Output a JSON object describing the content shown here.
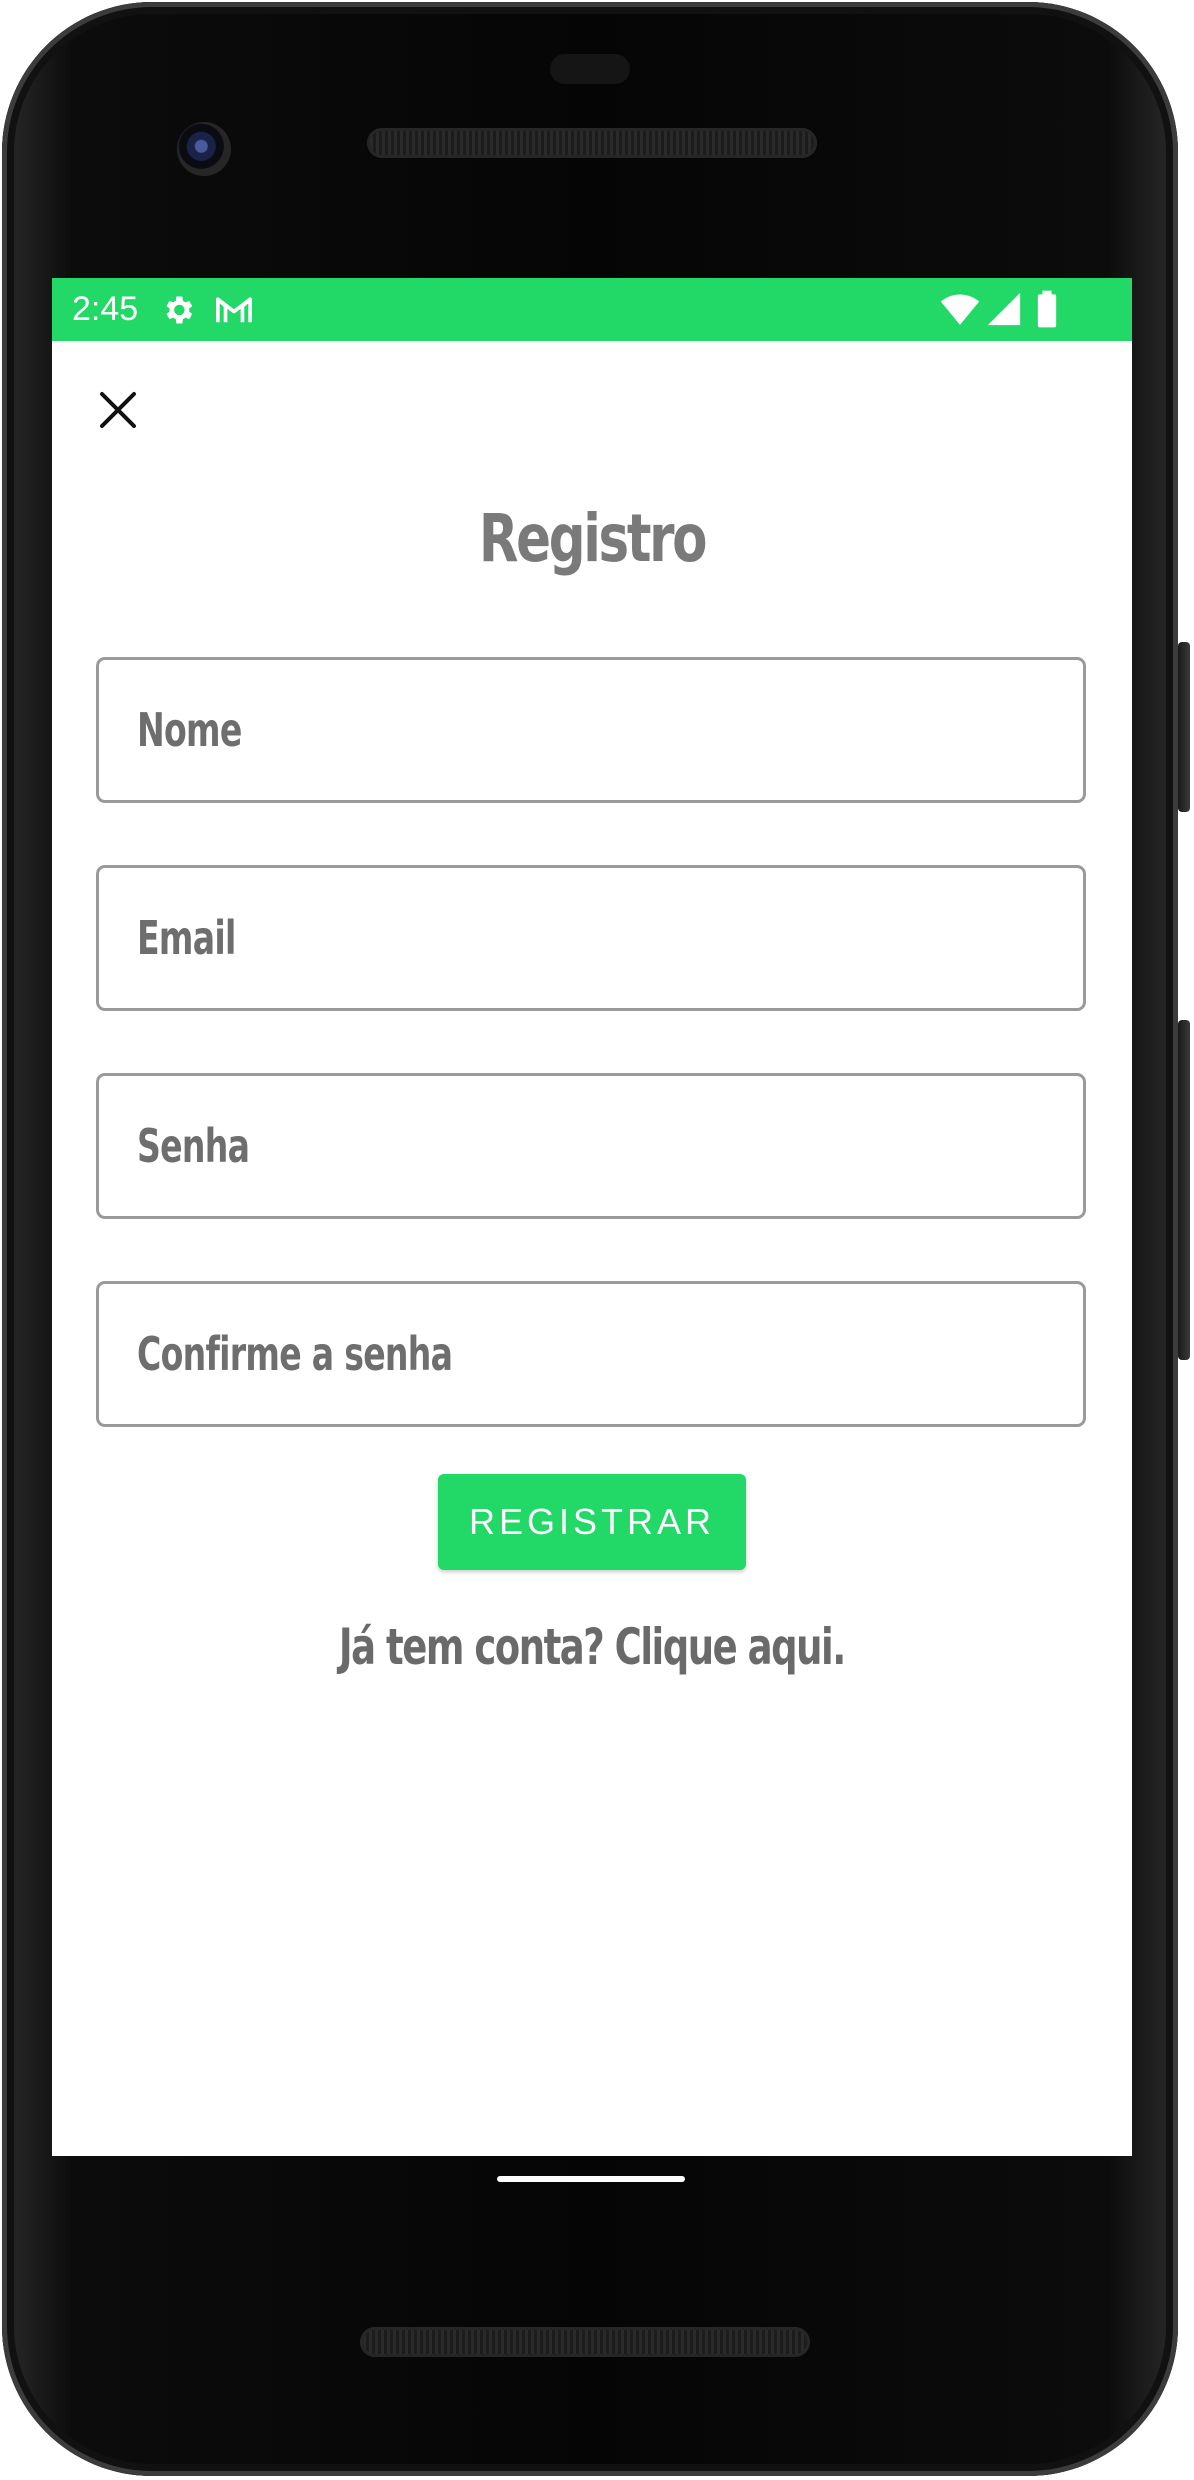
{
  "status_bar": {
    "time": "2:45",
    "color": "#22d866",
    "icons": [
      "settings-icon",
      "gmail-icon",
      "wifi-icon",
      "signal-icon",
      "battery-icon"
    ]
  },
  "close_icon": "close-icon",
  "title": "Registro",
  "form": {
    "name": {
      "placeholder": "Nome",
      "value": ""
    },
    "email": {
      "placeholder": "Email",
      "value": ""
    },
    "password": {
      "placeholder": "Senha",
      "value": ""
    },
    "confirm_password": {
      "placeholder": "Confirme a senha",
      "value": ""
    }
  },
  "register_button": {
    "label": "REGISTRAR",
    "color": "#22d866"
  },
  "login_link": "Já tem conta? Clique aqui.",
  "text_color": "#6e6e6e"
}
